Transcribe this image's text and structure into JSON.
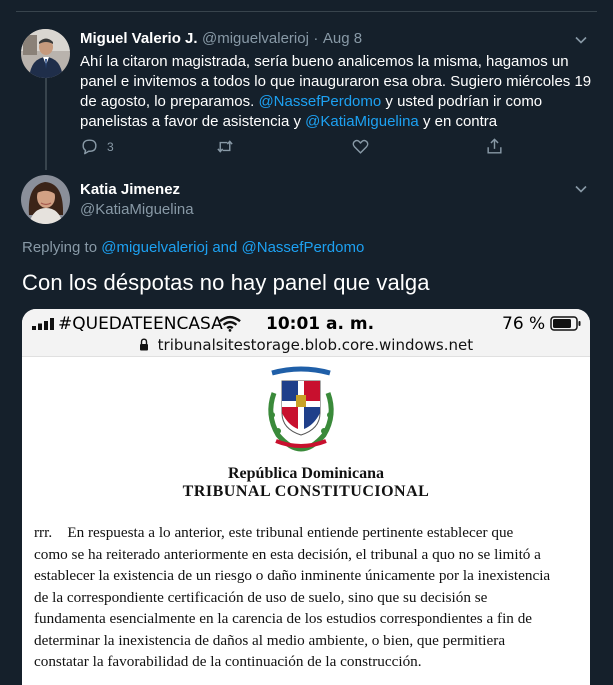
{
  "tweet1": {
    "display_name": "Miguel Valerio J.",
    "handle": "@miguelvalerioj",
    "separator": "·",
    "date": "Aug 8",
    "text_part1": "Ahí la citaron magistrada, sería bueno analicemos la misma, hagamos un panel e invitemos a todos lo que inauguraron esa obra. Sugiero miércoles 19 de agosto, lo preparamos.",
    "mention1": "@NassefPerdomo",
    "text_part2": "y usted podrían ir como panelistas a favor de asistencia y",
    "mention2": "@KatiaMiguelina",
    "text_part3": "y  en contra",
    "reply_count": "3"
  },
  "tweet2": {
    "display_name": "Katia Jimenez",
    "handle": "@KatiaMiguelina",
    "replying_prefix": "Replying to",
    "replying_user1": "@miguelvalerioj",
    "replying_and": "and",
    "replying_user2": "@NassefPerdomo",
    "text": "Con los déspotas no hay panel que valga"
  },
  "media": {
    "carrier": "#QUEDATEENCASA",
    "time": "10:01 a. m.",
    "battery": "76 %",
    "url": "tribunalsitestorage.blob.core.windows.net",
    "doc_title1": "República Dominicana",
    "doc_title2": "TRIBUNAL CONSTITUCIONAL",
    "doc_lines": [
      "rrr.    En respuesta a lo anterior, este tribunal entiende pertinente establecer que",
      "como se ha reiterado anteriormente en esta decisión, el tribunal a quo no se limitó a",
      "establecer la existencia de un riesgo o daño inminente únicamente por la inexistencia",
      "de la correspondiente certificación de uso de suelo, sino que su decisión se",
      "fundamenta esencialmente en la carencia de los estudios correspondientes a fin de",
      "determinar la inexistencia de daños al medio ambiente, o bien, que permitiera",
      "constatar la favorabilidad de la continuación de la construcción."
    ]
  },
  "colors": {
    "background": "#15202b",
    "link": "#1da1f2",
    "muted": "#8899a6",
    "divider": "#38444d"
  },
  "icons": [
    "reply-icon",
    "retweet-icon",
    "like-icon",
    "share-icon",
    "chevron-down-icon",
    "wifi-icon",
    "signal-icon",
    "battery-icon",
    "lock-icon",
    "coat-of-arms-emblem"
  ]
}
